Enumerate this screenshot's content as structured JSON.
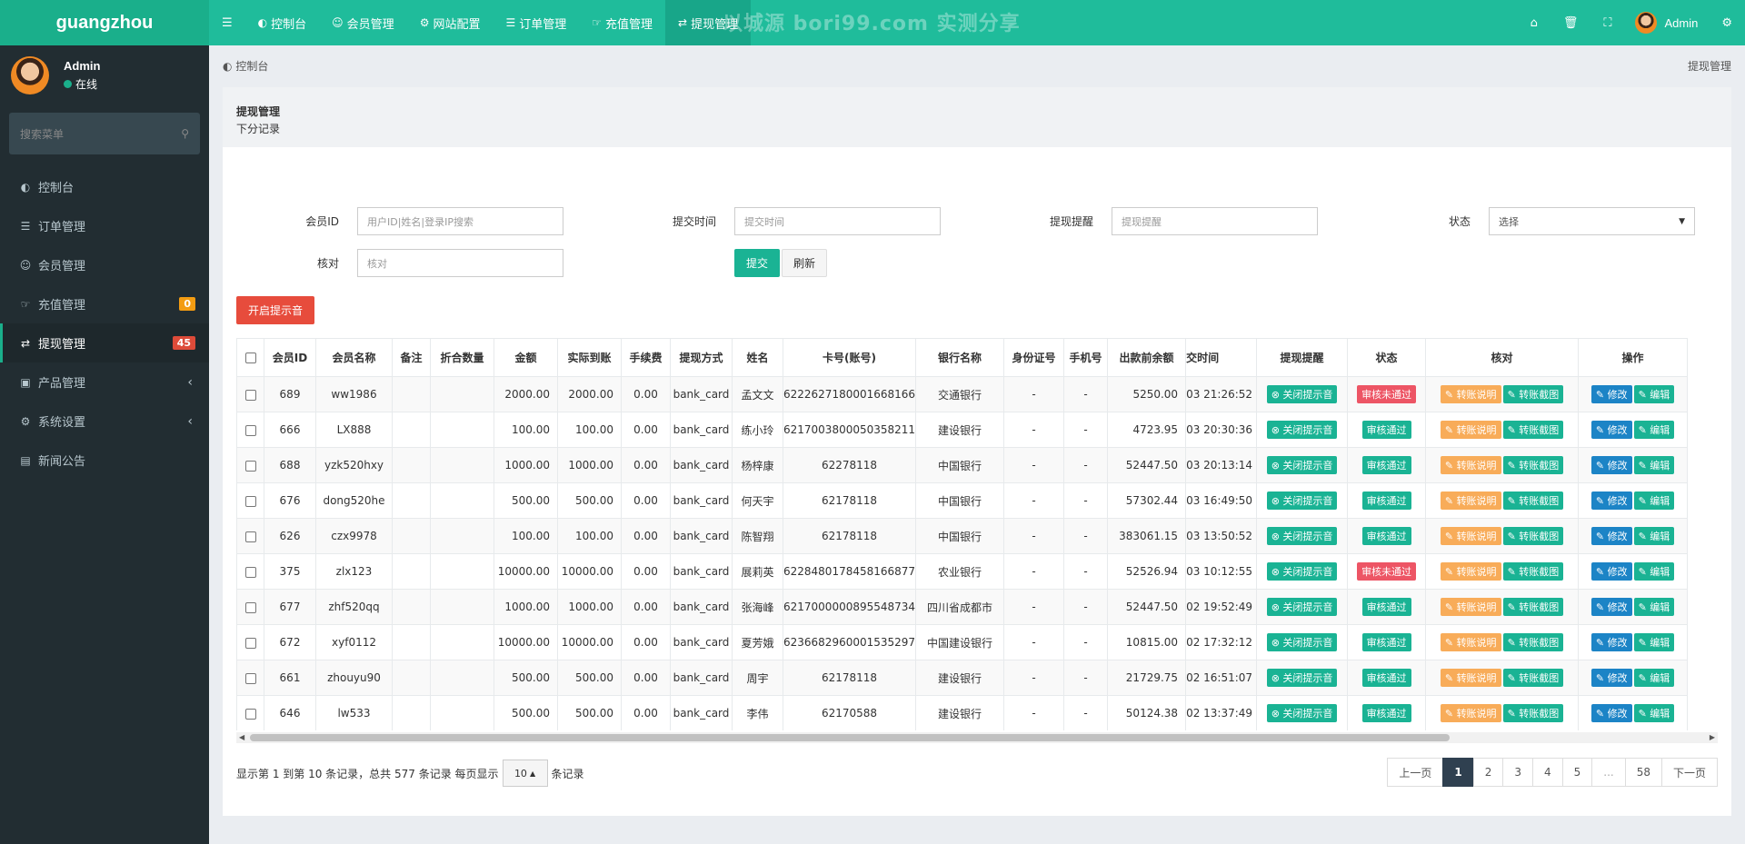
{
  "app": {
    "logo": "guangzhou"
  },
  "user": {
    "name": "Admin",
    "status": "在线"
  },
  "sidebar": {
    "search_placeholder": "搜索菜单",
    "items": [
      {
        "label": "控制台",
        "icon": "dashboard-icon"
      },
      {
        "label": "订单管理",
        "icon": "list-icon"
      },
      {
        "label": "会员管理",
        "icon": "users-icon"
      },
      {
        "label": "充值管理",
        "icon": "hand-icon",
        "badge": "0"
      },
      {
        "label": "提现管理",
        "icon": "withdraw-icon",
        "badge": "45",
        "active": true
      },
      {
        "label": "产品管理",
        "icon": "shopping-bag-icon"
      },
      {
        "label": "系统设置",
        "icon": "cogs-icon"
      },
      {
        "label": "新闻公告",
        "icon": "news-icon"
      }
    ]
  },
  "topnav": {
    "items": [
      {
        "label": "控制台"
      },
      {
        "label": "会员管理"
      },
      {
        "label": "网站配置"
      },
      {
        "label": "订单管理"
      },
      {
        "label": "充值管理"
      },
      {
        "label": "提现管理"
      }
    ],
    "watermark": "以城源 bori99.com 实测分享",
    "user": "Admin"
  },
  "breadcrumb": {
    "home": "控制台",
    "current": "提现管理"
  },
  "panel": {
    "title": "提现管理",
    "subtitle": "下分记录"
  },
  "filters": {
    "member_id_label": "会员ID",
    "member_id_placeholder": "用户ID|姓名|登录IP搜索",
    "submit_time_label": "提交时间",
    "submit_time_placeholder": "提交时间",
    "reminder_label": "提现提醒",
    "reminder_placeholder": "提现提醒",
    "status_label": "状态",
    "status_value": "选择",
    "verify_label": "核对",
    "verify_placeholder": "核对",
    "submit_button": "提交",
    "refresh_button": "刷新",
    "sound_button": "开启提示音"
  },
  "table": {
    "headers": [
      "会员ID",
      "会员名称",
      "备注",
      "折合数量",
      "金额",
      "实际到账",
      "手续费",
      "提现方式",
      "姓名",
      "卡号(账号)",
      "银行名称",
      "身份证号",
      "手机号",
      "出款前余额",
      "交时间",
      "提现提醒",
      "状态",
      "核对",
      "操作"
    ],
    "rows": [
      {
        "id": "689",
        "name": "ww1986",
        "amount": "2000.00",
        "actual": "2000.00",
        "fee": "0.00",
        "method": "bank_card",
        "real_name": "孟文文",
        "card": "6222627180001668166",
        "bank": "交通银行",
        "idcard": "-",
        "phone": "-",
        "balance": "5250.00",
        "time": "03 21:26:52",
        "status": "审核未通过"
      },
      {
        "id": "666",
        "name": "LX888",
        "amount": "100.00",
        "actual": "100.00",
        "fee": "0.00",
        "method": "bank_card",
        "real_name": "练小玲",
        "card": "6217003800050358211",
        "bank": "建设银行",
        "idcard": "-",
        "phone": "-",
        "balance": "4723.95",
        "time": "03 20:30:36",
        "status": "审核通过"
      },
      {
        "id": "688",
        "name": "yzk520hxy",
        "amount": "1000.00",
        "actual": "1000.00",
        "fee": "0.00",
        "method": "bank_card",
        "real_name": "杨梓康",
        "card": "62278118",
        "bank": "中国银行",
        "idcard": "-",
        "phone": "-",
        "balance": "52447.50",
        "time": "03 20:13:14",
        "status": "审核通过"
      },
      {
        "id": "676",
        "name": "dong520he",
        "amount": "500.00",
        "actual": "500.00",
        "fee": "0.00",
        "method": "bank_card",
        "real_name": "何天宇",
        "card": "62178118",
        "bank": "中国银行",
        "idcard": "-",
        "phone": "-",
        "balance": "57302.44",
        "time": "03 16:49:50",
        "status": "审核通过"
      },
      {
        "id": "626",
        "name": "czx9978",
        "amount": "100.00",
        "actual": "100.00",
        "fee": "0.00",
        "method": "bank_card",
        "real_name": "陈智翔",
        "card": "62178118",
        "bank": "中国银行",
        "idcard": "-",
        "phone": "-",
        "balance": "383061.15",
        "time": "03 13:50:52",
        "status": "审核通过"
      },
      {
        "id": "375",
        "name": "zlx123",
        "amount": "10000.00",
        "actual": "10000.00",
        "fee": "0.00",
        "method": "bank_card",
        "real_name": "展莉英",
        "card": "6228480178458166877",
        "bank": "农业银行",
        "idcard": "-",
        "phone": "-",
        "balance": "52526.94",
        "time": "03 10:12:55",
        "status": "审核未通过"
      },
      {
        "id": "677",
        "name": "zhf520qq",
        "amount": "1000.00",
        "actual": "1000.00",
        "fee": "0.00",
        "method": "bank_card",
        "real_name": "张海峰",
        "card": "6217000000895548734",
        "bank": "四川省成都市",
        "idcard": "-",
        "phone": "-",
        "balance": "52447.50",
        "time": "02 19:52:49",
        "status": "审核通过"
      },
      {
        "id": "672",
        "name": "xyf0112",
        "amount": "10000.00",
        "actual": "10000.00",
        "fee": "0.00",
        "method": "bank_card",
        "real_name": "夏芳娥",
        "card": "6236682960001535297",
        "bank": "中国建设银行",
        "idcard": "-",
        "phone": "-",
        "balance": "10815.00",
        "time": "02 17:32:12",
        "status": "审核通过"
      },
      {
        "id": "661",
        "name": "zhouyu90",
        "amount": "500.00",
        "actual": "500.00",
        "fee": "0.00",
        "method": "bank_card",
        "real_name": "周宇",
        "card": "62178118",
        "bank": "建设银行",
        "idcard": "-",
        "phone": "-",
        "balance": "21729.75",
        "time": "02 16:51:07",
        "status": "审核通过"
      },
      {
        "id": "646",
        "name": "lw533",
        "amount": "500.00",
        "actual": "500.00",
        "fee": "0.00",
        "method": "bank_card",
        "real_name": "李伟",
        "card": "62170588",
        "bank": "建设银行",
        "idcard": "-",
        "phone": "-",
        "balance": "50124.38",
        "time": "02 13:37:49",
        "status": "审核通过"
      }
    ],
    "action_labels": {
      "reminder": "关闭提示音",
      "explain": "转账说明",
      "screenshot": "转账截图",
      "modify": "修改",
      "edit": "编辑"
    }
  },
  "footer": {
    "info_prefix": "显示第 1 到第 10 条记录，总共 577 条记录 每页显示",
    "page_size": "10",
    "info_suffix": "条记录",
    "pages": [
      "上一页",
      "1",
      "2",
      "3",
      "4",
      "5",
      "...",
      "58",
      "下一页"
    ],
    "current_page": "1"
  },
  "colors": {
    "brand": "#1fbc9b",
    "sidebar": "#222d32",
    "danger": "#e74c3c",
    "warning": "#f8ac59",
    "primary": "#1c84c6"
  }
}
